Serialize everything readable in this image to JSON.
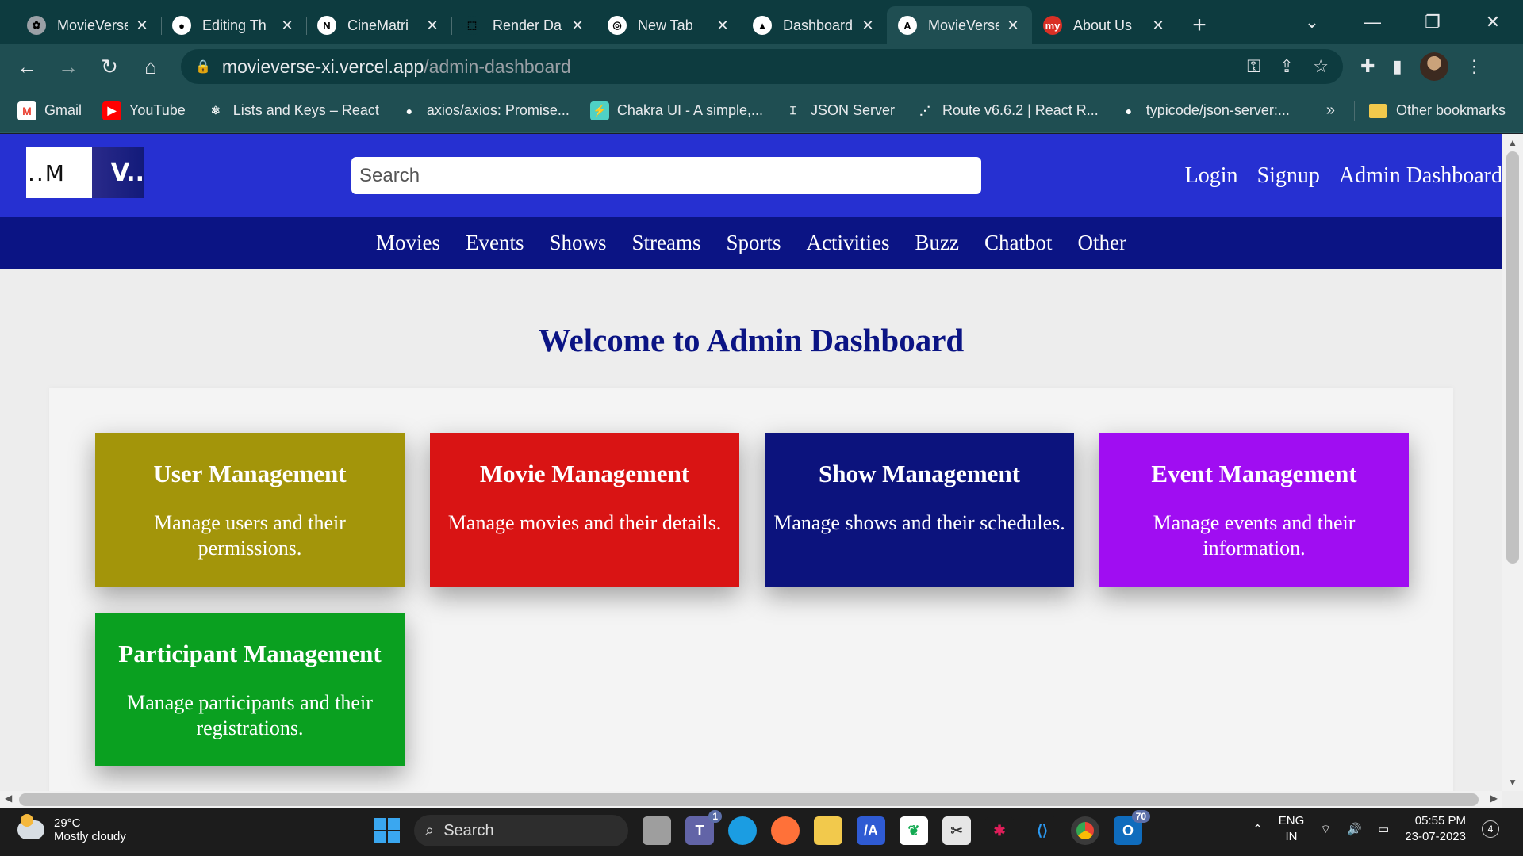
{
  "browser": {
    "tabs": [
      {
        "title": "MovieVerse",
        "fav_bg": "#9aa0a6",
        "fav": "✿"
      },
      {
        "title": "Editing Th",
        "fav_bg": "#ffffff",
        "fav": "●"
      },
      {
        "title": "CineMatri",
        "fav_bg": "#ffffff",
        "fav": "N"
      },
      {
        "title": "Render Da",
        "fav_bg": "#0d3b3f",
        "fav": "⬚"
      },
      {
        "title": "New Tab",
        "fav_bg": "#ffffff",
        "fav": "◎"
      },
      {
        "title": "Dashboard",
        "fav_bg": "#ffffff",
        "fav": "▲"
      },
      {
        "title": "MovieVerse",
        "fav_bg": "#ffffff",
        "fav": "A"
      },
      {
        "title": "About Us",
        "fav_bg": "#d93025",
        "fav": "my"
      }
    ],
    "new_tab": "+",
    "url_host": "movieverse-xi.vercel.app",
    "url_path": "/admin-dashboard",
    "bookmarks": [
      {
        "label": "Gmail",
        "icon_bg": "#ffffff",
        "icon": "M"
      },
      {
        "label": "YouTube",
        "icon_bg": "#ff0000",
        "icon": "▶"
      },
      {
        "label": "Lists and Keys – React",
        "icon_bg": "#1f4e52",
        "icon": "⚛"
      },
      {
        "label": "axios/axios: Promise...",
        "icon_bg": "#1f4e52",
        "icon": "●"
      },
      {
        "label": "Chakra UI - A simple,...",
        "icon_bg": "#4fd1c5",
        "icon": "⚡"
      },
      {
        "label": "JSON Server",
        "icon_bg": "#1f4e52",
        "icon": "⌶"
      },
      {
        "label": "Route v6.6.2 | React R...",
        "icon_bg": "#1f4e52",
        "icon": "⋰"
      },
      {
        "label": "typicode/json-server:...",
        "icon_bg": "#1f4e52",
        "icon": "●"
      }
    ],
    "bookmarks_more": "»",
    "other_bookmarks": "Other bookmarks"
  },
  "site": {
    "logo_left": "..M",
    "logo_right": "V..",
    "search_placeholder": "Search",
    "auth": {
      "login": "Login",
      "signup": "Signup",
      "admin": "Admin Dashboard"
    },
    "nav": [
      "Movies",
      "Events",
      "Shows",
      "Streams",
      "Sports",
      "Activities",
      "Buzz",
      "Chatbot",
      "Other"
    ],
    "welcome": "Welcome to Admin Dashboard",
    "cards": [
      {
        "title": "User Management",
        "desc": "Manage users and their permissions.",
        "color": "#a3950a"
      },
      {
        "title": "Movie Management",
        "desc": "Manage movies and their details.",
        "color": "#d91414"
      },
      {
        "title": "Show Management",
        "desc": "Manage shows and their schedules.",
        "color": "#0c137d"
      },
      {
        "title": "Event Management",
        "desc": "Manage events and their information.",
        "color": "#a00df2"
      },
      {
        "title": "Participant Management",
        "desc": "Manage participants and their registrations.",
        "color": "#0aa020"
      }
    ]
  },
  "taskbar": {
    "temp": "29°C",
    "condition": "Mostly cloudy",
    "search": "Search",
    "lang1": "ENG",
    "lang2": "IN",
    "time": "05:55 PM",
    "date": "23-07-2023",
    "notifications": "4",
    "teams_badge": "1",
    "outlook_badge": "70"
  }
}
